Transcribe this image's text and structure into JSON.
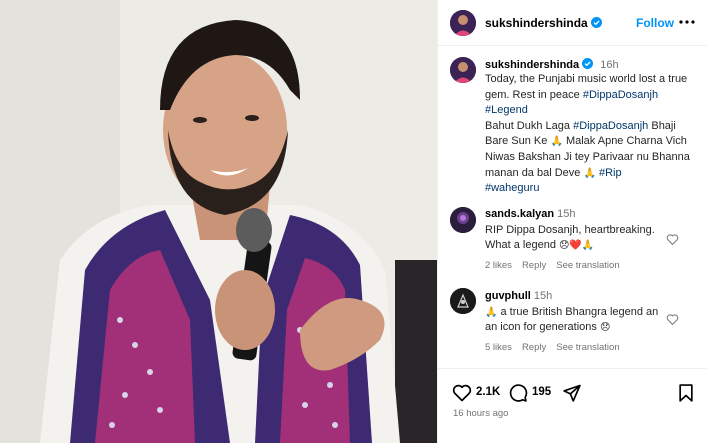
{
  "post": {
    "username": "sukshindershinda",
    "follow_label": "Follow",
    "caption": {
      "username": "sukshindershinda",
      "time": "16h",
      "line1": "Today, the Punjabi music world  lost a true gem. Rest in peace ",
      "tag1": "#DippaDosanjh",
      "tag2": "#Legend",
      "line2a": "Bahut Dukh Laga ",
      "tag3": "#DippaDosanjh",
      "line2b": "  Bhaji Bare Sun Ke ",
      "line2c": " Malak Apne Charna Vich Niwas Bakshan Ji tey Parivaar nu Bhanna manan da bal Deve ",
      "tag4": "#Rip",
      "tag5": "#waheguru"
    },
    "comments": [
      {
        "username": "sands.kalyan",
        "time": "15h",
        "text": "RIP Dippa Dosanjh, heartbreaking. What a legend ",
        "likes": "2 likes",
        "reply": "Reply",
        "translate": "See translation"
      },
      {
        "username": "guvphull",
        "time": "15h",
        "text": " a true British Bhangra legend an an icon for generations ",
        "likes": "5 likes",
        "reply": "Reply",
        "translate": "See translation"
      }
    ],
    "like_count": "2.1K",
    "comment_count": "195",
    "posted_ago": "16 hours ago"
  },
  "colors": {
    "link": "#0095f6",
    "hashtag": "#00376b",
    "muted": "#737373",
    "verified": "#0095f6"
  },
  "icons": [
    "verified-badge-icon",
    "more-options-icon",
    "heart-icon",
    "comment-icon",
    "share-icon",
    "bookmark-icon"
  ]
}
